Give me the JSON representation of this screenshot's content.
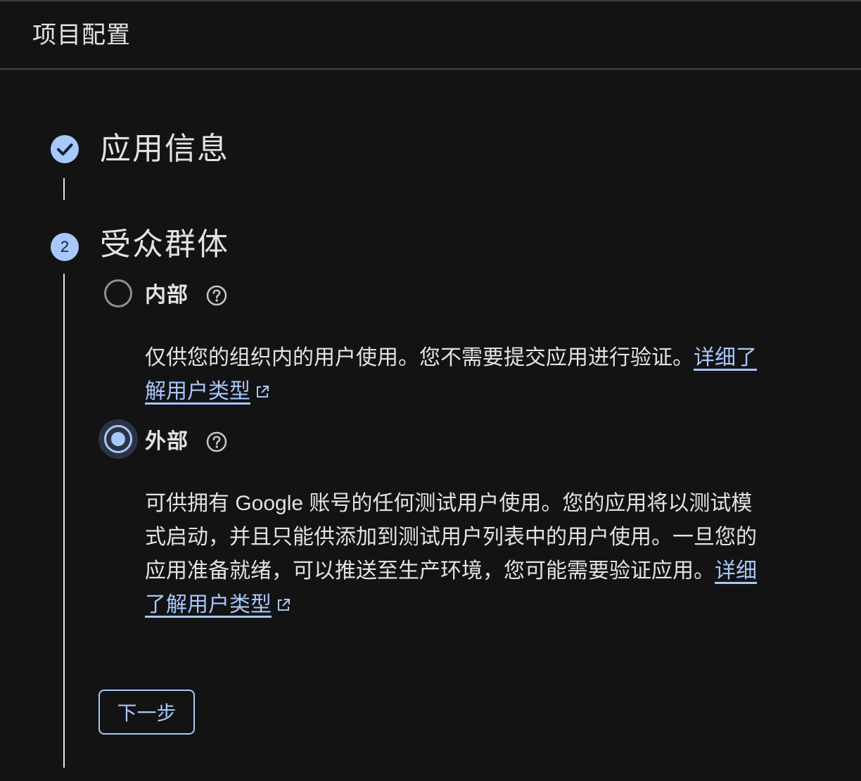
{
  "header": {
    "title": "项目配置"
  },
  "steps": [
    {
      "status": "completed",
      "icon": "check-icon",
      "title": "应用信息"
    },
    {
      "status": "active",
      "number": "2",
      "title": "受众群体"
    }
  ],
  "audience": {
    "selected": "external",
    "options": [
      {
        "key": "internal",
        "label": "内部",
        "help_icon": "help-icon",
        "description": "仅供您的组织内的用户使用。您不需要提交应用进行验证。",
        "link_text": "详细了解用户类型",
        "link_icon": "external-link-icon"
      },
      {
        "key": "external",
        "label": "外部",
        "help_icon": "help-icon",
        "description": "可供拥有 Google 账号的任何测试用户使用。您的应用将以测试模式启动，并且只能供添加到测试用户列表中的用户使用。一旦您的应用准备就绪，可以推送至生产环境，您可能需要验证应用。",
        "link_text": "详细了解用户类型",
        "link_icon": "external-link-icon"
      }
    ]
  },
  "next_button": {
    "label": "下一步"
  },
  "colors": {
    "background": "#131314",
    "text": "#e3e3e3",
    "accent": "#a8c7fa",
    "radio_unselected": "#8e918f",
    "divider": "#444746"
  }
}
